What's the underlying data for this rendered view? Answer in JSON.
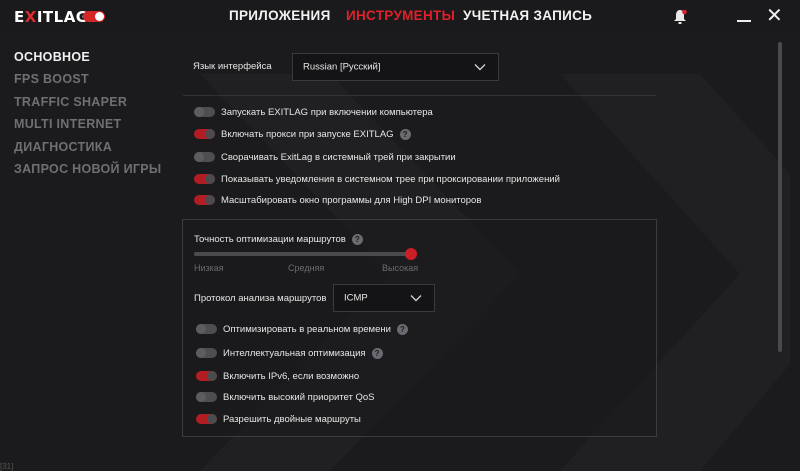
{
  "app": {
    "logo_prefix": "E",
    "logo_mark": "X",
    "logo_suffix": "ITLAG"
  },
  "nav": {
    "apps": "ПРИЛОЖЕНИЯ",
    "tools": "ИНСТРУМЕНТЫ",
    "account": "УЧЕТНАЯ ЗАПИСЬ"
  },
  "window": {
    "close": "✕"
  },
  "sidebar": {
    "items": [
      {
        "label": "ОСНОВНОЕ"
      },
      {
        "label": "FPS BOOST"
      },
      {
        "label": "TRAFFIC SHAPER"
      },
      {
        "label": "MULTI INTERNET"
      },
      {
        "label": "ДИАГНОСТИКА"
      },
      {
        "label": "ЗАПРОС НОВОЙ ИГРЫ"
      }
    ]
  },
  "language": {
    "label": "Язык интерфейса",
    "value": "Russian [Русский]"
  },
  "options": [
    {
      "label": "Запускать EXITLAG при включении компьютера",
      "on": false
    },
    {
      "label": "Включать прокси при запуске EXITLAG",
      "on": true
    },
    {
      "label": "Сворачивать ExitLag в системный трей при закрытии",
      "on": false
    },
    {
      "label": "Показывать уведомления в системном трее при проксировании приложений",
      "on": true
    },
    {
      "label": "Масштабировать окно программы для High DPI мониторов",
      "on": true
    }
  ],
  "routing": {
    "precision_label": "Точность оптимизации маршрутов",
    "precision_level": 1.0,
    "ticks": [
      "Низкая",
      "Средняя",
      "Высокая"
    ],
    "protocol_label": "Протокол анализа маршрутов",
    "protocol_value": "ICMP"
  },
  "advanced": [
    {
      "label": "Оптимизировать в реальном времени",
      "on": false
    },
    {
      "label": "Интеллектуальная оптимизация",
      "on": false
    },
    {
      "label": "Включить IPv6, если возможно",
      "on": true
    },
    {
      "label": "Включить высокий приоритет QoS",
      "on": false
    },
    {
      "label": "Разрешить двойные маршруты",
      "on": true
    }
  ],
  "help_glyph": "?",
  "footer": "[31]",
  "colors": {
    "accent": "#e0202a",
    "toggle_on": "#b11d22",
    "bg": "#1b1b1d"
  }
}
